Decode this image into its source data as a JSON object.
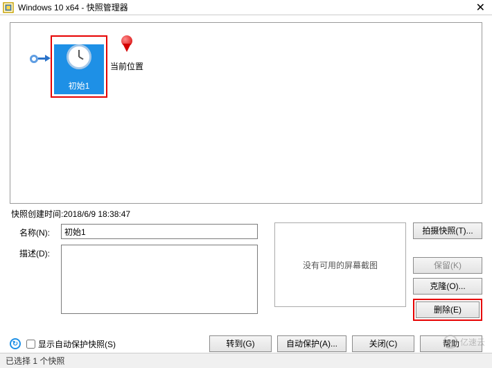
{
  "titlebar": {
    "title": "Windows 10 x64 - 快照管理器"
  },
  "tree": {
    "snapshot_name": "初始1",
    "current_pos": "当前位置"
  },
  "info": {
    "created_label": "快照创建时间:2018/6/9 18:38:47"
  },
  "form": {
    "name_label": "名称(N):",
    "name_value": "初始1",
    "desc_label": "描述(D):",
    "desc_value": ""
  },
  "preview": {
    "no_screenshot": "没有可用的屏幕截图"
  },
  "buttons": {
    "take": "拍摄快照(T)...",
    "keep": "保留(K)",
    "clone": "克隆(O)...",
    "delete": "删除(E)"
  },
  "bottom": {
    "checkbox": "显示自动保护快照(S)",
    "goto": "转到(G)",
    "autoprotect": "自动保护(A)...",
    "close": "关闭(C)",
    "help": "帮助"
  },
  "status": {
    "selected": "已选择 1 个快照"
  },
  "watermark": "亿速云"
}
